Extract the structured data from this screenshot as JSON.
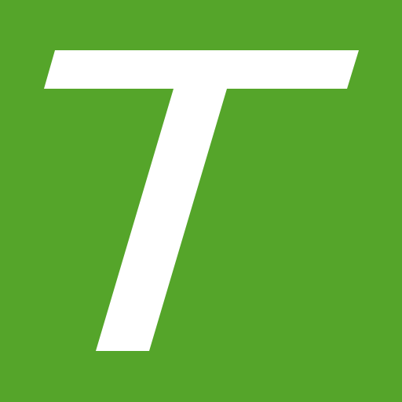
{
  "logo": {
    "letter": "T",
    "icon": "letter-t-logo-icon"
  },
  "colors": {
    "background": "#55a52a",
    "letter": "#ffffff"
  }
}
